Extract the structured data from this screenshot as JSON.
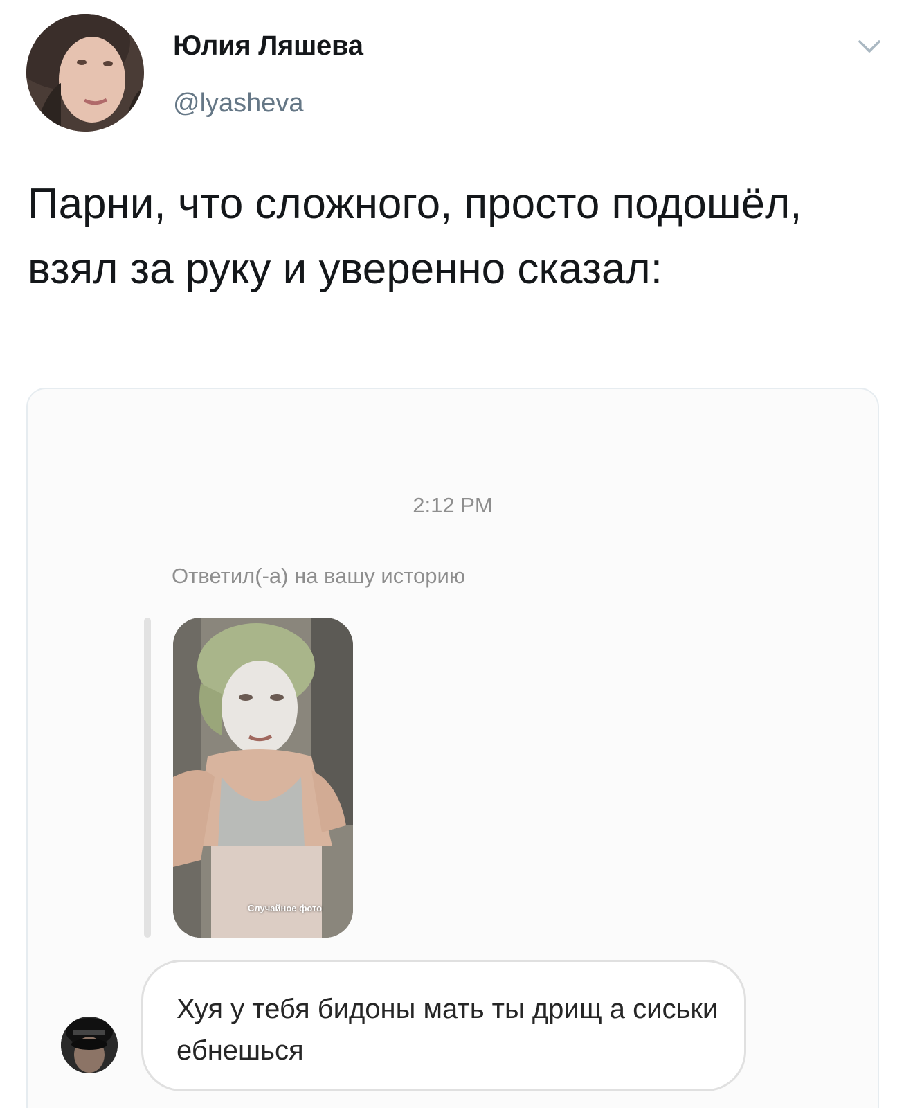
{
  "tweet": {
    "author_name": "Юлия Ляшева",
    "author_handle": "@lyasheva",
    "text": "Парни, что сложного, просто подошёл, взял за руку и уверенно сказал:",
    "menu_icon": "chevron-down-icon"
  },
  "embedded_screenshot": {
    "timestamp": "2:12 PM",
    "reply_caption": "Ответил(-а) на вашу историю",
    "story_label": "Случайное фото",
    "message_text": "Хуя у тебя бидоны мать ты дрищ а сиськи ебнешься"
  },
  "colors": {
    "name": "#14171a",
    "handle": "#657786",
    "card_border": "#e6ecf0",
    "meta_gray": "#8e8e8e"
  }
}
